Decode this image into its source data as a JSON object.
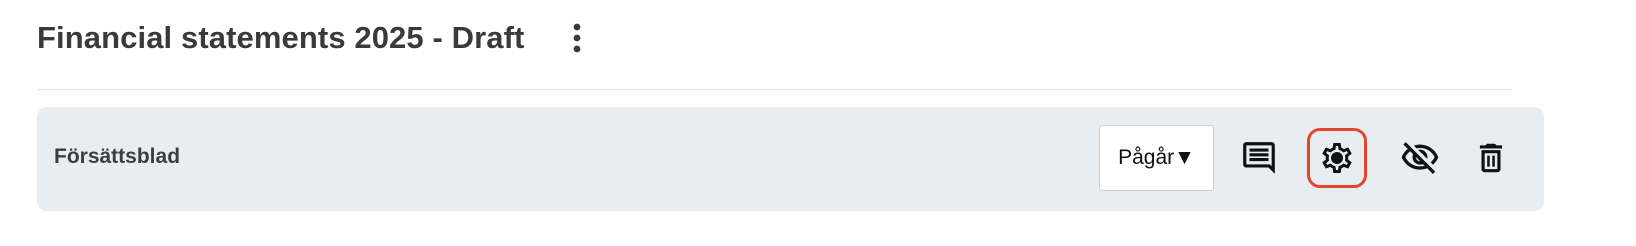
{
  "header": {
    "title": "Financial statements 2025 - Draft",
    "more_icon": "kebab-vertical-icon"
  },
  "section": {
    "title": "Försättsblad",
    "status": {
      "selected": "Pågår",
      "arrow": "▼"
    },
    "actions": {
      "comment_icon": "comment-icon",
      "settings_icon": "gear-icon",
      "hide_icon": "eye-off-icon",
      "delete_icon": "trash-icon"
    },
    "highlight_color": "#e0482e",
    "background_color": "#e8edf2"
  }
}
